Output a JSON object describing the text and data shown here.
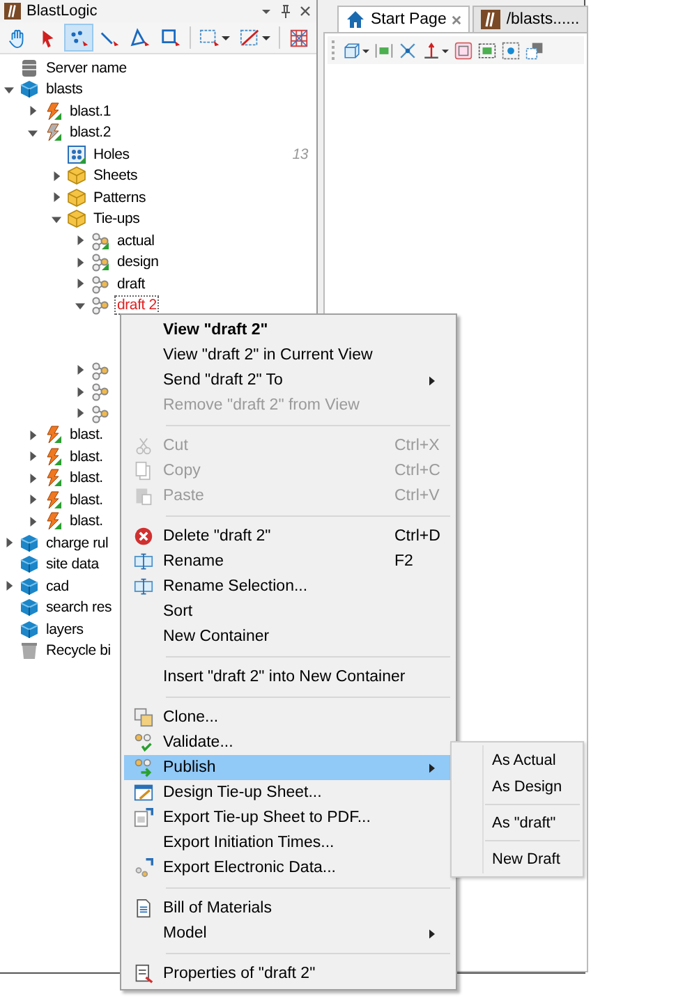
{
  "panel": {
    "title": "BlastLogic"
  },
  "toolbar": [
    {
      "selected": false
    },
    {
      "selected": false
    },
    {
      "selected": true
    },
    {
      "selected": false
    },
    {
      "selected": false
    },
    {
      "selected": false
    },
    {
      "selected": false
    },
    {
      "selected": false
    },
    {
      "selected": false
    }
  ],
  "tree": [
    {
      "kind": "server",
      "label": "Server name"
    },
    {
      "kind": "container",
      "label": "blasts",
      "expanded": true,
      "children": [
        {
          "kind": "blast",
          "label": "blast.1",
          "expanded": false,
          "valid": true,
          "color": "#f07820"
        },
        {
          "kind": "blast",
          "label": "blast.2",
          "expanded": true,
          "valid": true,
          "color": "#b0b0b0",
          "children": [
            {
              "kind": "holes",
              "label": "Holes",
              "count": "13"
            },
            {
              "kind": "folder",
              "label": "Sheets",
              "expanded": false
            },
            {
              "kind": "folder",
              "label": "Patterns",
              "expanded": false
            },
            {
              "kind": "folder",
              "label": "Tie-ups",
              "expanded": true,
              "children": [
                {
                  "kind": "tieup",
                  "label": "actual",
                  "expanded": false,
                  "valid": true,
                  "selected": false
                },
                {
                  "kind": "tieup",
                  "label": "design",
                  "expanded": false,
                  "valid": true,
                  "selected": false
                },
                {
                  "kind": "tieup",
                  "label": "draft",
                  "expanded": false,
                  "valid": false,
                  "selected": false
                },
                {
                  "kind": "tieup",
                  "label": "draft 2",
                  "expanded": true,
                  "valid": false,
                  "selected": true
                },
                {
                  "kind": "gap"
                },
                {
                  "kind": "gap"
                },
                {
                  "kind": "tieup",
                  "expanded": false,
                  "valid": false
                },
                {
                  "kind": "tieup",
                  "expanded": false,
                  "valid": false
                },
                {
                  "kind": "tieup",
                  "expanded": false,
                  "valid": false
                }
              ]
            }
          ]
        },
        {
          "kind": "blast",
          "label": "blast.",
          "expanded": false,
          "valid": true,
          "color": "#f07820"
        },
        {
          "kind": "blast",
          "label": "blast.",
          "expanded": false,
          "valid": true,
          "color": "#f07820"
        },
        {
          "kind": "blast",
          "label": "blast.",
          "expanded": false,
          "valid": true,
          "color": "#f07820"
        },
        {
          "kind": "blast",
          "label": "blast.",
          "expanded": false,
          "valid": true,
          "color": "#f07820"
        },
        {
          "kind": "blast",
          "label": "blast.",
          "expanded": false,
          "valid": true,
          "color": "#f07820"
        }
      ]
    },
    {
      "kind": "container",
      "label": "charge rul",
      "expanded": false
    },
    {
      "kind": "container",
      "label": "site data"
    },
    {
      "kind": "container",
      "label": "cad",
      "expanded": false
    },
    {
      "kind": "container",
      "label": "search res"
    },
    {
      "kind": "container",
      "label": "layers"
    },
    {
      "kind": "recycle",
      "label": "Recycle bi"
    }
  ],
  "tabs": [
    {
      "label": "Start Page",
      "selected": true,
      "closable": true
    },
    {
      "label": "/blasts......",
      "selected": false,
      "closable": false
    }
  ],
  "menu": [
    {
      "kind": "item",
      "label": "View \"draft 2\"",
      "default": true,
      "disabled": false,
      "selected": false
    },
    {
      "kind": "item",
      "label": "View \"draft 2\" in Current View",
      "default": false,
      "disabled": false,
      "selected": false
    },
    {
      "kind": "item",
      "label": "Send \"draft 2\" To",
      "default": false,
      "disabled": false,
      "selected": false,
      "has_submenu": true
    },
    {
      "kind": "item",
      "label": "Remove \"draft 2\" from View",
      "default": false,
      "disabled": true,
      "selected": false
    },
    {
      "kind": "separator"
    },
    {
      "kind": "item",
      "label": "Cut",
      "shortcut": "Ctrl+X",
      "default": false,
      "disabled": true,
      "selected": false
    },
    {
      "kind": "item",
      "label": "Copy",
      "shortcut": "Ctrl+C",
      "default": false,
      "disabled": true,
      "selected": false
    },
    {
      "kind": "item",
      "label": "Paste",
      "shortcut": "Ctrl+V",
      "default": false,
      "disabled": true,
      "selected": false
    },
    {
      "kind": "separator"
    },
    {
      "kind": "item",
      "label": "Delete \"draft 2\"",
      "shortcut": "Ctrl+D",
      "default": false,
      "disabled": false,
      "selected": false
    },
    {
      "kind": "item",
      "label": "Rename",
      "shortcut": "F2",
      "default": false,
      "disabled": false,
      "selected": false
    },
    {
      "kind": "item",
      "label": "Rename Selection...",
      "default": false,
      "disabled": false,
      "selected": false
    },
    {
      "kind": "item",
      "label": "Sort",
      "default": false,
      "disabled": false,
      "selected": false
    },
    {
      "kind": "item",
      "label": "New Container",
      "default": false,
      "disabled": false,
      "selected": false
    },
    {
      "kind": "separator"
    },
    {
      "kind": "item",
      "label": "Insert \"draft 2\" into New Container",
      "default": false,
      "disabled": false,
      "selected": false
    },
    {
      "kind": "separator"
    },
    {
      "kind": "item",
      "label": "Clone...",
      "default": false,
      "disabled": false,
      "selected": false
    },
    {
      "kind": "item",
      "label": "Validate...",
      "default": false,
      "disabled": false,
      "selected": false
    },
    {
      "kind": "item",
      "label": "Publish",
      "default": false,
      "disabled": false,
      "selected": true,
      "has_submenu": true,
      "submenu_items": [
        {
          "kind": "item",
          "label": "As Actual"
        },
        {
          "kind": "item",
          "label": "As Design"
        },
        {
          "kind": "separator"
        },
        {
          "kind": "item",
          "label": "As \"draft\""
        },
        {
          "kind": "separator"
        },
        {
          "kind": "item",
          "label": "New Draft"
        }
      ]
    },
    {
      "kind": "item",
      "label": "Design Tie-up Sheet...",
      "default": false,
      "disabled": false,
      "selected": false
    },
    {
      "kind": "item",
      "label": "Export Tie-up Sheet to PDF...",
      "default": false,
      "disabled": false,
      "selected": false
    },
    {
      "kind": "item",
      "label": "Export Initiation Times...",
      "default": false,
      "disabled": false,
      "selected": false
    },
    {
      "kind": "item",
      "label": "Export Electronic Data...",
      "default": false,
      "disabled": false,
      "selected": false
    },
    {
      "kind": "separator"
    },
    {
      "kind": "item",
      "label": "Bill of Materials",
      "default": false,
      "disabled": false,
      "selected": false
    },
    {
      "kind": "item",
      "label": "Model",
      "default": false,
      "disabled": false,
      "selected": false,
      "has_submenu": true
    },
    {
      "kind": "separator"
    },
    {
      "kind": "item",
      "label": "Properties of \"draft 2\"",
      "default": false,
      "disabled": false,
      "selected": false
    }
  ]
}
